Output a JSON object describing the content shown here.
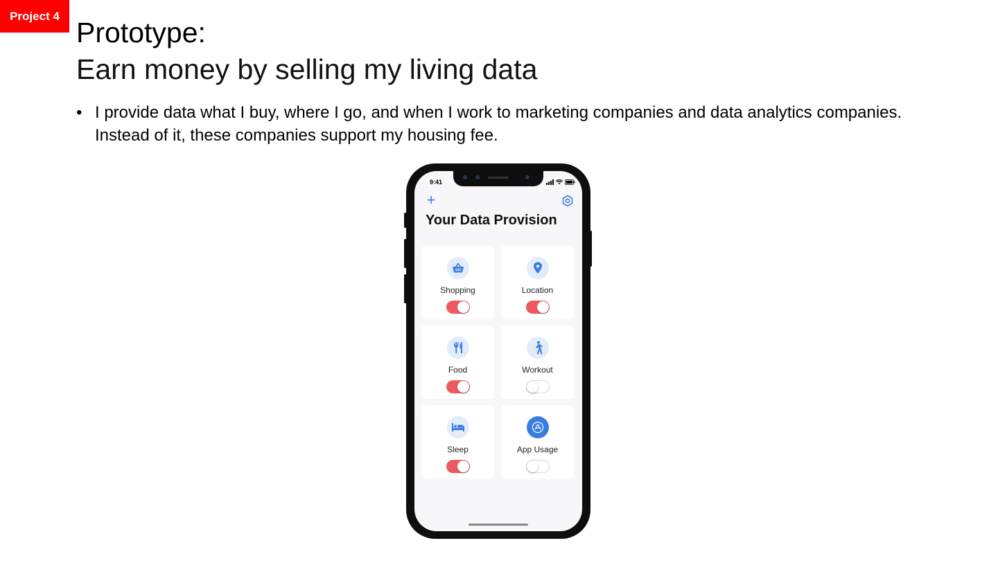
{
  "badge": "Project 4",
  "slide": {
    "title": "Prototype:",
    "subtitle": "Earn money by selling my living data",
    "bullet": "I provide data what I buy, where I go, and when I work to marketing companies and data analytics companies. Instead of it, these companies support my housing fee."
  },
  "phone": {
    "status_time": "9:41",
    "app_title": "Your Data Provision",
    "accent_color": "#3a7de0",
    "toggle_on_color": "#ec5a5f",
    "cards": [
      {
        "label": "Shopping",
        "icon": "basket-icon",
        "enabled": true
      },
      {
        "label": "Location",
        "icon": "map-pin-icon",
        "enabled": true
      },
      {
        "label": "Food",
        "icon": "fork-knife-icon",
        "enabled": true
      },
      {
        "label": "Workout",
        "icon": "walking-person-icon",
        "enabled": false
      },
      {
        "label": "Sleep",
        "icon": "bed-icon",
        "enabled": true
      },
      {
        "label": "App Usage",
        "icon": "app-store-icon",
        "enabled": false
      }
    ]
  }
}
